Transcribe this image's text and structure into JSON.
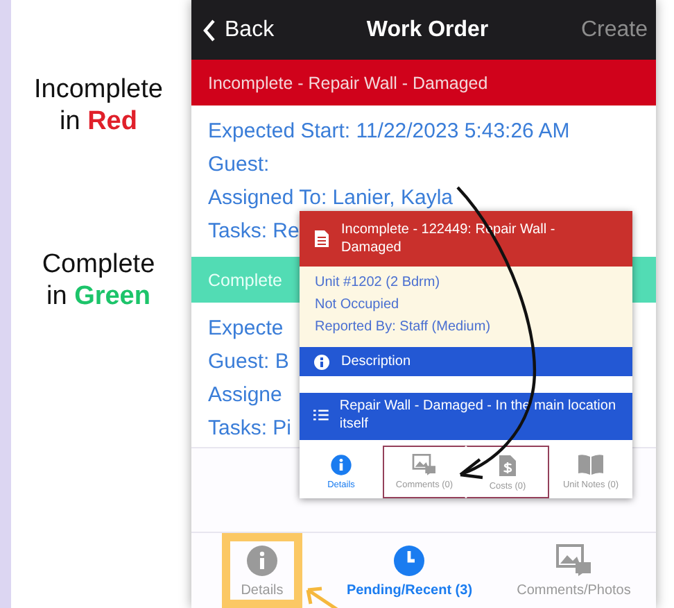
{
  "captions": [
    {
      "line": "Incomplete",
      "prefix": "in",
      "highlight": "Red",
      "color": "#e0202a"
    },
    {
      "line": "Complete",
      "prefix": "in",
      "highlight": "Green",
      "color": "#1cc46a"
    }
  ],
  "nav": {
    "back": "Back",
    "title": "Work Order",
    "action": "Create"
  },
  "orders": [
    {
      "kind": "incomplete",
      "banner": "Incomplete -  Repair Wall - Damaged",
      "lines": [
        "Expected Start: 11/22/2023 5:43:26 AM",
        "Guest:",
        "Assigned To: Lanier, Kayla",
        "Tasks: Re"
      ]
    },
    {
      "kind": "complete",
      "banner": "Complete",
      "lines": [
        "Expecte",
        "Guest: B",
        "Assigne",
        "Tasks: Pi"
      ]
    }
  ],
  "popup": {
    "kind": "incomplete",
    "title": "Incomplete - 122449: Repair Wall - Damaged",
    "info": [
      "Unit #1202 (2 Bdrm)",
      "Not Occupied",
      "Reported By: Staff  (Medium)"
    ],
    "section": "Description",
    "task": "Repair Wall - Damaged - In the main location itself",
    "tabs": [
      {
        "label": "Details",
        "kind": "info",
        "selected": true,
        "highlighted": false
      },
      {
        "label": "Comments (0)",
        "kind": "photo",
        "selected": false,
        "highlighted": true
      },
      {
        "label": "Costs (0)",
        "kind": "cost",
        "selected": false,
        "highlighted": true
      },
      {
        "label": "Unit Notes (0)",
        "kind": "book",
        "selected": false,
        "highlighted": false
      }
    ]
  },
  "tabs": [
    {
      "label": "Details",
      "kind": "info",
      "selected": false,
      "highlighted": true
    },
    {
      "label": "Pending/Recent (3)",
      "kind": "clock",
      "selected": true,
      "highlighted": false
    },
    {
      "label": "Comments/Photos",
      "kind": "photo",
      "selected": false,
      "highlighted": false
    }
  ]
}
